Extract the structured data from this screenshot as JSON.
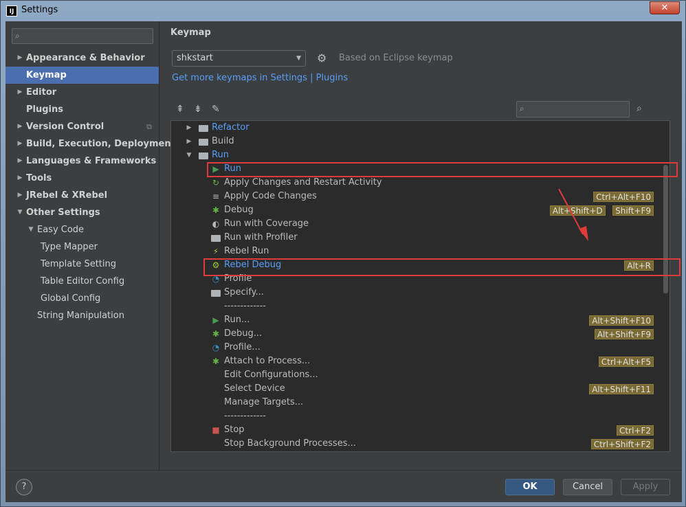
{
  "window": {
    "title": "Settings",
    "app_icon": "IJ",
    "close_glyph": "✕"
  },
  "sidebar": {
    "search_placeholder": "",
    "items": [
      {
        "label": "Appearance & Behavior",
        "arrow": "▶"
      },
      {
        "label": "Keymap",
        "arrow": ""
      },
      {
        "label": "Editor",
        "arrow": "▶"
      },
      {
        "label": "Plugins",
        "arrow": ""
      },
      {
        "label": "Version Control",
        "arrow": "▶"
      },
      {
        "label": "Build, Execution, Deployment",
        "arrow": "▶"
      },
      {
        "label": "Languages & Frameworks",
        "arrow": "▶"
      },
      {
        "label": "Tools",
        "arrow": "▶"
      },
      {
        "label": "JRebel & XRebel",
        "arrow": "▶"
      },
      {
        "label": "Other Settings",
        "arrow": "▼"
      },
      {
        "label": "Easy Code",
        "arrow": "▼"
      },
      {
        "label": "Type Mapper",
        "arrow": ""
      },
      {
        "label": "Template Setting",
        "arrow": ""
      },
      {
        "label": "Table Editor Config",
        "arrow": ""
      },
      {
        "label": "Global Config",
        "arrow": ""
      },
      {
        "label": "String Manipulation",
        "arrow": ""
      }
    ]
  },
  "main": {
    "heading": "Keymap",
    "keymap_selected": "shkstart",
    "based_on": "Based on Eclipse keymap",
    "plugins_link": "Get more keymaps in Settings | Plugins",
    "find_placeholder": ""
  },
  "tree": [
    {
      "label": "Refactor",
      "toggle": "▶",
      "shortcuts": []
    },
    {
      "label": "Build",
      "toggle": "▶",
      "shortcuts": []
    },
    {
      "label": "Run",
      "toggle": "▼",
      "shortcuts": []
    },
    {
      "label": "Run",
      "shortcuts": []
    },
    {
      "label": "Apply Changes and Restart Activity",
      "shortcuts": []
    },
    {
      "label": "Apply Code Changes",
      "shortcuts": [
        "Ctrl+Alt+F10"
      ]
    },
    {
      "label": "Debug",
      "shortcuts": [
        "Alt+Shift+D",
        "Shift+F9"
      ]
    },
    {
      "label": "Run with Coverage",
      "shortcuts": []
    },
    {
      "label": "Run with Profiler",
      "shortcuts": []
    },
    {
      "label": "Rebel Run",
      "shortcuts": []
    },
    {
      "label": "Rebel Debug",
      "shortcuts": [
        "Alt+R"
      ]
    },
    {
      "label": "Profile",
      "shortcuts": []
    },
    {
      "label": "Specify...",
      "shortcuts": []
    },
    {
      "label": "-------------",
      "shortcuts": []
    },
    {
      "label": "Run...",
      "shortcuts": [
        "Alt+Shift+F10"
      ]
    },
    {
      "label": "Debug...",
      "shortcuts": [
        "Alt+Shift+F9"
      ]
    },
    {
      "label": "Profile...",
      "shortcuts": []
    },
    {
      "label": "Attach to Process...",
      "shortcuts": [
        "Ctrl+Alt+F5"
      ]
    },
    {
      "label": "Edit Configurations...",
      "shortcuts": []
    },
    {
      "label": "Select Device",
      "shortcuts": [
        "Alt+Shift+F11"
      ]
    },
    {
      "label": "Manage Targets...",
      "shortcuts": []
    },
    {
      "label": "-------------",
      "shortcuts": []
    },
    {
      "label": "Stop",
      "shortcuts": [
        "Ctrl+F2"
      ]
    },
    {
      "label": "Stop Background Processes...",
      "shortcuts": [
        "Ctrl+Shift+F2"
      ]
    }
  ],
  "footer": {
    "help": "?",
    "ok": "OK",
    "cancel": "Cancel",
    "apply": "Apply"
  },
  "colors": {
    "accent": "#4b6eaf",
    "link": "#589df6",
    "highlight": "#e03b3b",
    "shortcut_bg": "#7a6a34"
  }
}
